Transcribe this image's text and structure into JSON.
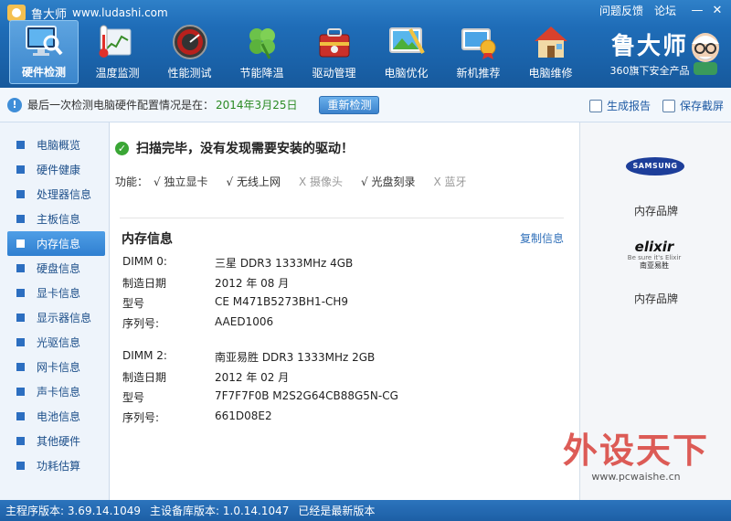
{
  "window": {
    "app_name": "鲁大师",
    "url": "www.ludashi.com",
    "links": [
      "问题反馈",
      "论坛"
    ],
    "controls": {
      "minimize": "—",
      "close": "✕"
    }
  },
  "toolbar": {
    "items": [
      {
        "label": "硬件检测",
        "icon": "monitor-magnifier-icon",
        "active": true
      },
      {
        "label": "温度监测",
        "icon": "thermometer-icon",
        "active": false
      },
      {
        "label": "性能测试",
        "icon": "speedometer-icon",
        "active": false
      },
      {
        "label": "节能降温",
        "icon": "clover-icon",
        "active": false
      },
      {
        "label": "驱动管理",
        "icon": "toolbox-icon",
        "active": false
      },
      {
        "label": "电脑优化",
        "icon": "screen-brush-icon",
        "active": false
      },
      {
        "label": "新机推荐",
        "icon": "award-icon",
        "active": false
      },
      {
        "label": "电脑维修",
        "icon": "house-icon",
        "active": false
      }
    ]
  },
  "brand": {
    "name": "鲁大师",
    "subtitle": "360旗下安全产品"
  },
  "infobar": {
    "message": "最后一次检测电脑硬件配置情况是在：",
    "date": "2014年3月25日",
    "recheck_label": "重新检测",
    "report_label": "生成报告",
    "screenshot_label": "保存截屏"
  },
  "sidebar": {
    "items": [
      {
        "label": "电脑概览"
      },
      {
        "label": "硬件健康"
      },
      {
        "label": "处理器信息"
      },
      {
        "label": "主板信息"
      },
      {
        "label": "内存信息",
        "active": true
      },
      {
        "label": "硬盘信息"
      },
      {
        "label": "显卡信息"
      },
      {
        "label": "显示器信息"
      },
      {
        "label": "光驱信息"
      },
      {
        "label": "网卡信息"
      },
      {
        "label": "声卡信息"
      },
      {
        "label": "电池信息"
      },
      {
        "label": "其他硬件"
      },
      {
        "label": "功耗估算"
      }
    ]
  },
  "main": {
    "scan_status": "扫描完毕，没有发现需要安装的驱动！",
    "features_label": "功能：",
    "features": [
      {
        "label": "√ 独立显卡",
        "enabled": true
      },
      {
        "label": "√ 无线上网",
        "enabled": true
      },
      {
        "label": "X 摄像头",
        "enabled": false
      },
      {
        "label": "√ 光盘刻录",
        "enabled": true
      },
      {
        "label": "X 蓝牙",
        "enabled": false
      }
    ],
    "section_title": "内存信息",
    "copy_label": "复制信息",
    "dimms": [
      {
        "rows": [
          {
            "key": "DIMM 0:",
            "value": "三星 DDR3 1333MHz 4GB"
          },
          {
            "key": "制造日期",
            "value": "2012 年 08 月"
          },
          {
            "key": "型号",
            "value": "CE M471B5273BH1-CH9"
          },
          {
            "key": "序列号:",
            "value": "AAED1006"
          }
        ]
      },
      {
        "rows": [
          {
            "key": "DIMM 2:",
            "value": "南亚易胜 DDR3 1333MHz 2GB"
          },
          {
            "key": "制造日期",
            "value": "2012 年 02 月"
          },
          {
            "key": "型号",
            "value": "7F7F7F0B M2S2G64CB88G5N-CG"
          },
          {
            "key": "序列号:",
            "value": "661D08E2"
          }
        ]
      }
    ]
  },
  "rightpanel": {
    "brands": [
      {
        "logo_text": "SAMSUNG",
        "label": "内存品牌"
      },
      {
        "logo_text": "elixir",
        "logo_tagline": "Be sure it's Elixir",
        "logo_sub": "南亚易胜",
        "label": "内存品牌"
      }
    ]
  },
  "statusbar": {
    "main_version": "主程序版本: 3.69.14.1049",
    "db_version": "主设备库版本: 1.0.14.1047",
    "status": "已经是最新版本"
  },
  "watermark": {
    "title": "外设天下",
    "url": "www.pcwaishe.cn"
  }
}
